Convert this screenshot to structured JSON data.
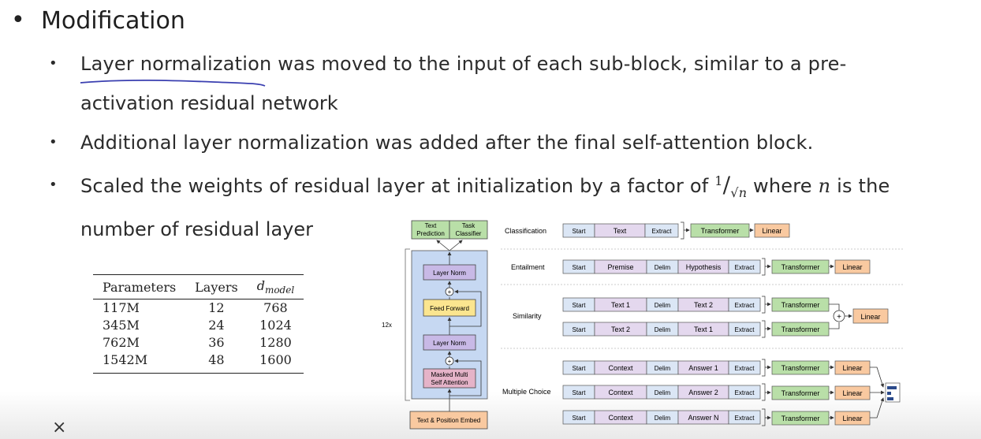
{
  "heading": "Modification",
  "bullets": [
    {
      "line1": "Layer normalization was moved to the input of each sub-block, similar to a pre-",
      "line2": "activation residual network"
    },
    {
      "line1": "Additional layer normalization was added after the final self-attention block."
    },
    {
      "line1_pre": "Scaled the weights of residual layer at initialization by a factor of ",
      "frac_num": "1",
      "frac_den": "√n",
      "line1_mid": " where ",
      "var": "n",
      "line1_post": " is the",
      "line2": "number of residual layer"
    }
  ],
  "table": {
    "headers": [
      "Parameters",
      "Layers",
      "d_model"
    ],
    "header_dmodel_main": "d",
    "header_dmodel_sub": "model",
    "rows": [
      [
        "117M",
        "12",
        "768"
      ],
      [
        "345M",
        "24",
        "1024"
      ],
      [
        "762M",
        "36",
        "1280"
      ],
      [
        "1542M",
        "48",
        "1600"
      ]
    ]
  },
  "architecture": {
    "repeat": "12x",
    "heads": [
      "Text Prediction",
      "Task Classifier"
    ],
    "blocks": [
      "Layer Norm",
      "Feed Forward",
      "Layer Norm",
      "Masked Multi Self Attention"
    ],
    "plus": "+",
    "embed": "Text & Position Embed"
  },
  "tasks": {
    "classification": {
      "label": "Classification",
      "tokens": [
        "Start",
        "Text",
        "Extract"
      ],
      "transformer": "Transformer",
      "linear": "Linear"
    },
    "entailment": {
      "label": "Entailment",
      "tokens": [
        "Start",
        "Premise",
        "Delim",
        "Hypothesis",
        "Extract"
      ],
      "transformer": "Transformer",
      "linear": "Linear"
    },
    "similarity": {
      "label": "Similarity",
      "rows": [
        [
          "Start",
          "Text 1",
          "Delim",
          "Text 2",
          "Extract"
        ],
        [
          "Start",
          "Text 2",
          "Delim",
          "Text 1",
          "Extract"
        ]
      ],
      "transformer": "Transformer",
      "plus": "+",
      "linear": "Linear"
    },
    "multiple_choice": {
      "label": "Multiple Choice",
      "rows": [
        [
          "Start",
          "Context",
          "Delim",
          "Answer 1",
          "Extract"
        ],
        [
          "Start",
          "Context",
          "Delim",
          "Answer 2",
          "Extract"
        ],
        [
          "Start",
          "Context",
          "Delim",
          "Answer N",
          "Extract"
        ]
      ],
      "transformer": "Transformer",
      "linear": "Linear"
    }
  },
  "controls": {
    "close": "×"
  },
  "colors": {
    "token_blue": "#dbe6f5",
    "token_purple": "#e4d8ee",
    "transformer_green": "#b9dfa8",
    "linear_orange": "#f9c9a0",
    "layernorm": "#c8b9e6",
    "feedforward": "#fbe58f",
    "attention": "#e5b3c8",
    "block_bg": "#c6d8f2"
  }
}
